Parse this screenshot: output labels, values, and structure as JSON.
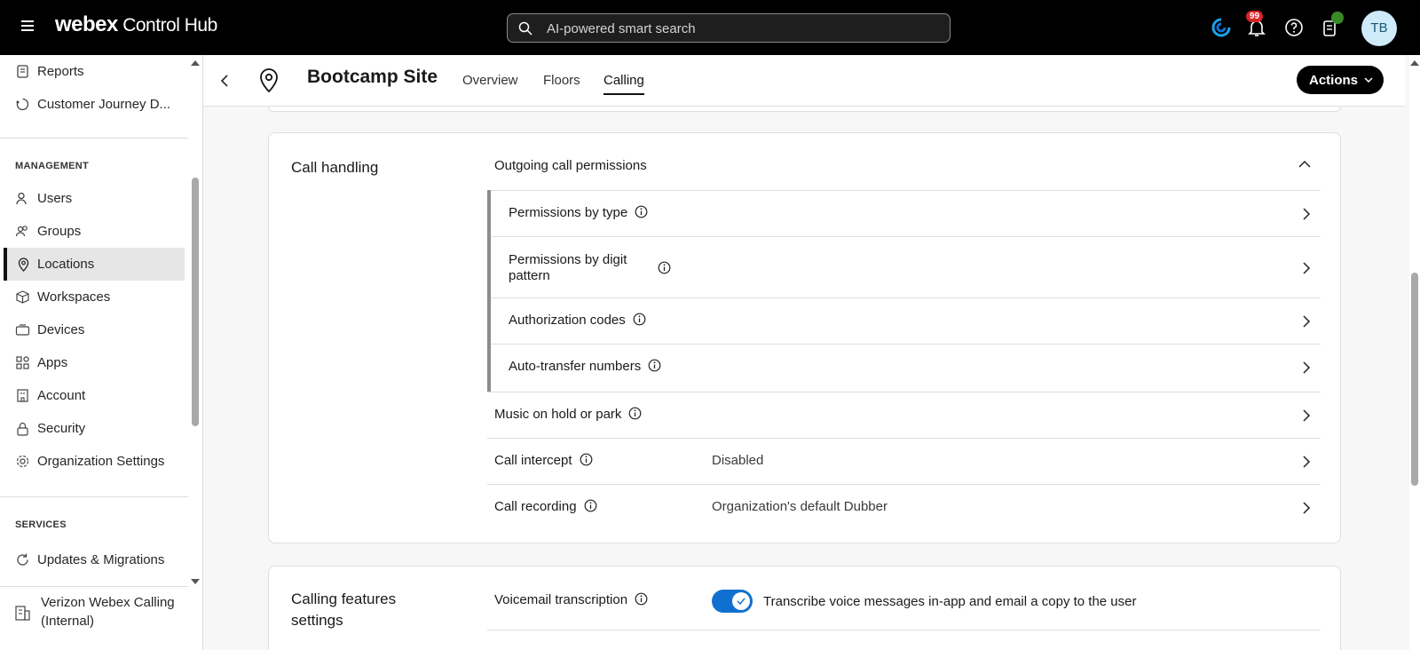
{
  "topbar": {
    "brand_bold": "webex",
    "brand_rest": " Control Hub",
    "search_placeholder": "AI-powered smart search",
    "notification_count": "99",
    "avatar_initials": "TB"
  },
  "sidebar": {
    "top_items": [
      {
        "label": "Reports",
        "icon": "reports-icon"
      },
      {
        "label": "Customer Journey D...",
        "icon": "journey-icon"
      }
    ],
    "management_header": "MANAGEMENT",
    "management_items": [
      {
        "label": "Users",
        "icon": "user-icon"
      },
      {
        "label": "Groups",
        "icon": "groups-icon"
      },
      {
        "label": "Locations",
        "icon": "location-pin-icon",
        "active": true
      },
      {
        "label": "Workspaces",
        "icon": "workspace-icon"
      },
      {
        "label": "Devices",
        "icon": "device-icon"
      },
      {
        "label": "Apps",
        "icon": "apps-icon"
      },
      {
        "label": "Account",
        "icon": "account-icon"
      },
      {
        "label": "Security",
        "icon": "lock-icon"
      },
      {
        "label": "Organization Settings",
        "icon": "gear-icon"
      }
    ],
    "services_header": "SERVICES",
    "services_items": [
      {
        "label": "Updates & Migrations",
        "icon": "refresh-icon"
      }
    ],
    "org_name_line1": "Verizon Webex Calling",
    "org_name_line2": "(Internal)"
  },
  "header": {
    "title": "Bootcamp Site",
    "tabs": [
      {
        "label": "Overview"
      },
      {
        "label": "Floors"
      },
      {
        "label": "Calling",
        "active": true
      }
    ],
    "actions_label": "Actions"
  },
  "call_handling": {
    "title": "Call handling",
    "outgoing_label": "Outgoing call permissions",
    "sub_rows": [
      {
        "label": "Permissions by type"
      },
      {
        "label_line1": "Permissions by digit",
        "label_line2": "pattern"
      },
      {
        "label": "Authorization codes"
      },
      {
        "label": "Auto-transfer numbers"
      }
    ],
    "rows": [
      {
        "label": "Music on hold or park",
        "value": ""
      },
      {
        "label": "Call intercept",
        "value": "Disabled"
      },
      {
        "label": "Call recording",
        "value": "Organization's default Dubber"
      }
    ]
  },
  "calling_features": {
    "title_line1": "Calling features",
    "title_line2": "settings",
    "voicemail_label": "Voicemail transcription",
    "voicemail_toggle_on": true,
    "voicemail_desc": "Transcribe voice messages in-app and email a copy to the user"
  },
  "colors": {
    "accent_blue": "#1170cf",
    "badge_red": "#d9242c",
    "avatar_bg": "#cfeaf8"
  }
}
